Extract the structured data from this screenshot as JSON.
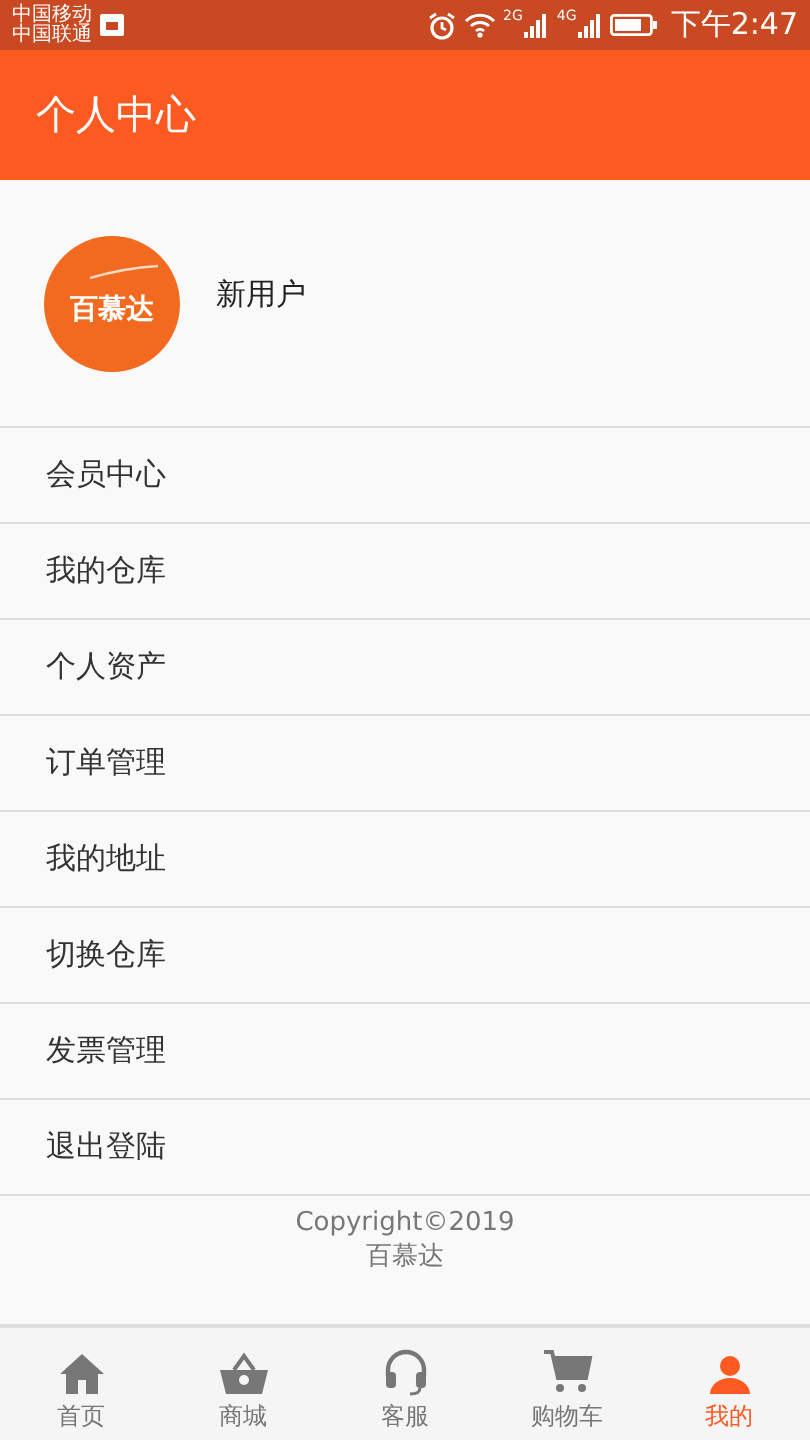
{
  "status_bar": {
    "carriers": [
      "中国移动",
      "中国联通"
    ],
    "network_labels": [
      "2G",
      "4G"
    ],
    "time": "下午2:47"
  },
  "header": {
    "title": "个人中心"
  },
  "profile": {
    "logo_text": "百慕达",
    "name": "新用户"
  },
  "menu": [
    {
      "label": "会员中心"
    },
    {
      "label": "我的仓库"
    },
    {
      "label": "个人资产"
    },
    {
      "label": "订单管理"
    },
    {
      "label": "我的地址"
    },
    {
      "label": "切换仓库"
    },
    {
      "label": "发票管理"
    },
    {
      "label": "退出登陆"
    }
  ],
  "footer": {
    "copyright": "Copyright©2019",
    "company": "百慕达"
  },
  "tabs": [
    {
      "label": "首页",
      "kind": "home",
      "selected": false
    },
    {
      "label": "商城",
      "kind": "basket",
      "selected": false
    },
    {
      "label": "客服",
      "kind": "headset",
      "selected": false
    },
    {
      "label": "购物车",
      "kind": "cart",
      "selected": false
    },
    {
      "label": "我的",
      "kind": "user",
      "selected": true
    }
  ]
}
